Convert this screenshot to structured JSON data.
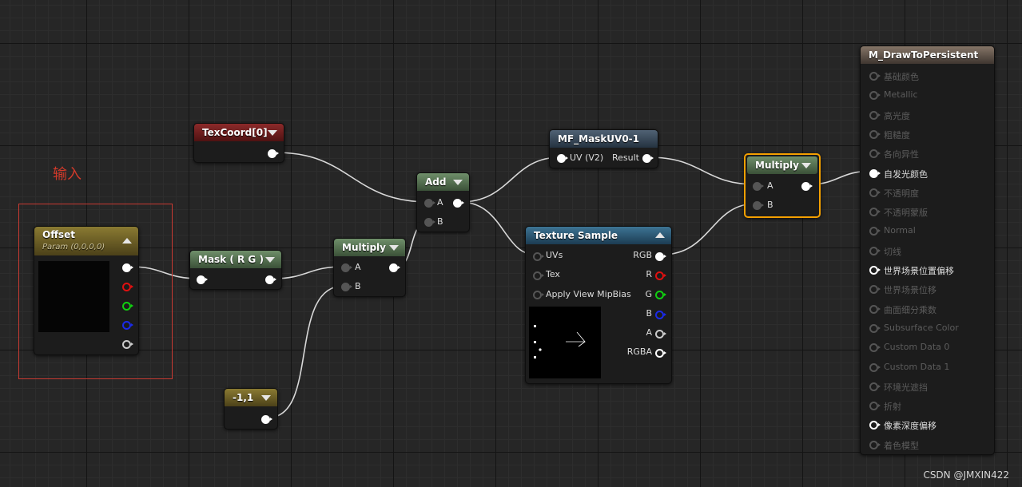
{
  "annotation": {
    "label": "输入",
    "color": "#d23a2a"
  },
  "watermark": "CSDN @JMXIN422",
  "nodes": {
    "texcoord": {
      "title": "TexCoord[0]",
      "color": "#8c2a2a"
    },
    "offset": {
      "title": "Offset",
      "subtitle": "Param (0,0,0,0)",
      "color": "#8a7a32"
    },
    "mask": {
      "title": "Mask ( R G )"
    },
    "multiply1": {
      "title": "Multiply",
      "inputs": [
        "A",
        "B"
      ]
    },
    "const": {
      "title": "-1,1"
    },
    "add": {
      "title": "Add",
      "inputs": [
        "A",
        "B"
      ]
    },
    "mf_mask": {
      "title": "MF_MaskUV0-1",
      "input": "UV (V2)",
      "output": "Result"
    },
    "texture_sample": {
      "title": "Texture Sample",
      "inputs": [
        "UVs",
        "Tex",
        "Apply View MipBias"
      ],
      "outputs": [
        "RGB",
        "R",
        "G",
        "B",
        "A",
        "RGBA"
      ]
    },
    "multiply2": {
      "title": "Multiply",
      "inputs": [
        "A",
        "B"
      ],
      "selected": true
    },
    "material": {
      "title": "M_DrawToPersistent",
      "pins": [
        {
          "label": "基础颜色",
          "active": false
        },
        {
          "label": "Metallic",
          "active": false
        },
        {
          "label": "高光度",
          "active": false
        },
        {
          "label": "粗糙度",
          "active": false
        },
        {
          "label": "各向异性",
          "active": false
        },
        {
          "label": "自发光颜色",
          "active": true,
          "connected": true
        },
        {
          "label": "不透明度",
          "active": false
        },
        {
          "label": "不透明蒙版",
          "active": false
        },
        {
          "label": "Normal",
          "active": false
        },
        {
          "label": "切线",
          "active": false
        },
        {
          "label": "世界场景位置偏移",
          "active": true,
          "connected": false
        },
        {
          "label": "世界场景位移",
          "active": false
        },
        {
          "label": "曲面细分乘数",
          "active": false
        },
        {
          "label": "Subsurface Color",
          "active": false
        },
        {
          "label": "Custom Data 0",
          "active": false
        },
        {
          "label": "Custom Data 1",
          "active": false
        },
        {
          "label": "环境光遮挡",
          "active": false
        },
        {
          "label": "折射",
          "active": false
        },
        {
          "label": "像素深度偏移",
          "active": true,
          "connected": false
        },
        {
          "label": "着色模型",
          "active": false
        }
      ]
    }
  }
}
